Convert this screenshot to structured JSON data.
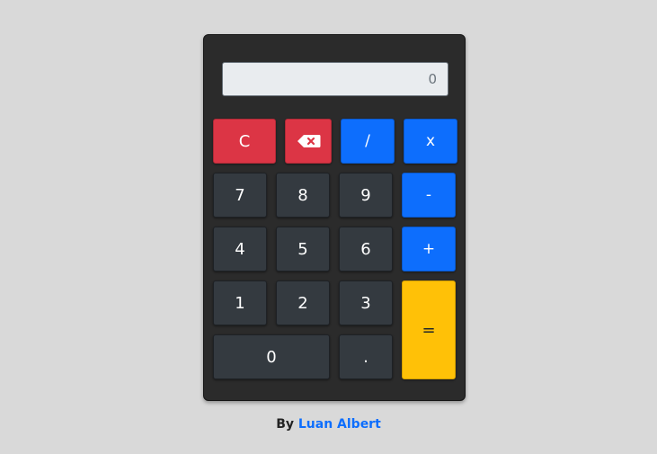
{
  "display": {
    "value": "0"
  },
  "keys": {
    "clear": "C",
    "backspace_icon": "backspace-icon",
    "divide": "/",
    "multiply": "x",
    "seven": "7",
    "eight": "8",
    "nine": "9",
    "subtract": "-",
    "four": "4",
    "five": "5",
    "six": "6",
    "add": "+",
    "one": "1",
    "two": "2",
    "three": "3",
    "equals": "=",
    "zero": "0",
    "decimal": "."
  },
  "footer": {
    "prefix": "By",
    "author": "Luan Albert"
  },
  "colors": {
    "background": "#d9d9d9",
    "body": "#2b2b2b",
    "number_key": "#343a40",
    "operator_key": "#0d6efd",
    "danger_key": "#dc3545",
    "equals_key": "#ffc107",
    "author_link": "#0d6efd"
  }
}
